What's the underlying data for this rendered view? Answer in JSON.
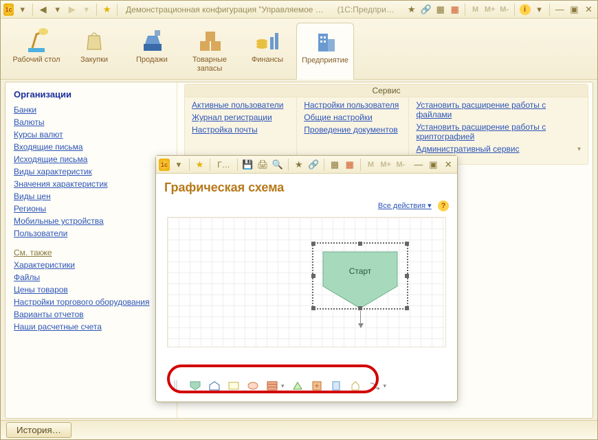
{
  "title": "Демонстрационная конфигурация \"Управляемое приложен…",
  "title_suffix": "(1С:Предприятие)",
  "main_tabs": [
    {
      "label": "Рабочий стол"
    },
    {
      "label": "Закупки"
    },
    {
      "label": "Продажи"
    },
    {
      "label": "Товарные запасы"
    },
    {
      "label": "Финансы"
    },
    {
      "label": "Предприятие"
    }
  ],
  "sidebar": {
    "header": "Организации",
    "links": [
      "Банки",
      "Валюты",
      "Курсы валют",
      "Входящие письма",
      "Исходящие письма",
      "Виды характеристик",
      "Значения характеристик",
      "Виды цен",
      "Регионы",
      "Мобильные устройства",
      "Пользователи"
    ],
    "also_header": "См. также",
    "also_links": [
      "Характеристики",
      "Файлы",
      "Цены товаров",
      "Настройки торгового оборудования",
      "Варианты отчетов",
      "Наши расчетные счета"
    ]
  },
  "service": {
    "header": "Сервис",
    "col1": [
      "Активные пользователи",
      "Журнал регистрации",
      "Настройка почты"
    ],
    "col2": [
      "Настройки пользователя",
      "Общие настройки",
      "Проведение документов"
    ],
    "col3": [
      "Установить расширение работы с файлами",
      "Установить расширение работы с криптографией",
      "Административный сервис"
    ]
  },
  "childwin": {
    "tab_abbrev": "Г…",
    "title": "Графическая схема",
    "actions_label": "Все действия",
    "start_label": "Старт"
  },
  "status": {
    "history": "История…"
  },
  "colors": {
    "start_fill": "#a7d9bd",
    "start_stroke": "#6fae8a"
  }
}
